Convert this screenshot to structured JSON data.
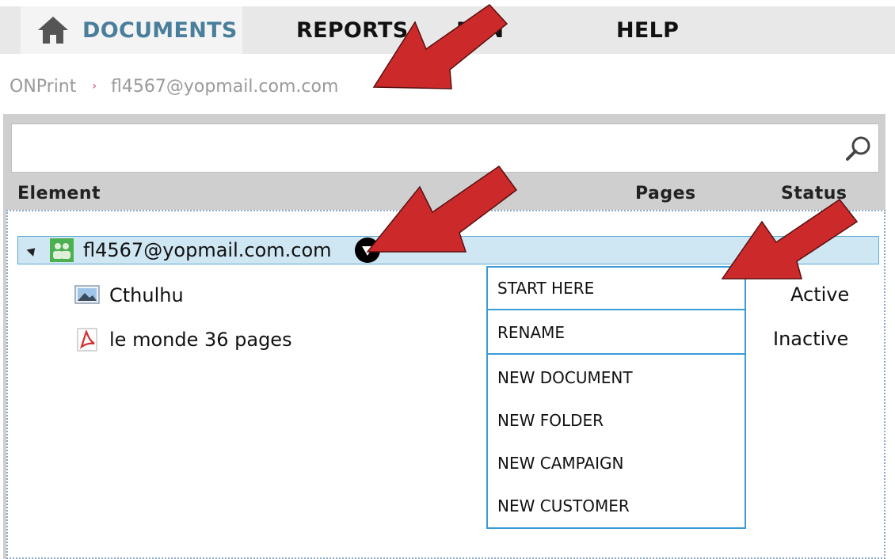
{
  "nav": {
    "tabs": [
      {
        "label": "DOCUMENTS",
        "active": true,
        "icon": "home-icon"
      },
      {
        "label": "REPORTS",
        "active": false
      },
      {
        "label": "MIN",
        "active": false
      },
      {
        "label": "HELP",
        "active": false
      }
    ]
  },
  "breadcrumb": {
    "root": "ONPrint",
    "separator": "›",
    "current": "fl4567@yopmail.com.com"
  },
  "search": {
    "value": "",
    "icon": "search-icon"
  },
  "table": {
    "columns": [
      "Element",
      "Pages",
      "Status"
    ],
    "root": {
      "label": "fl4567@yopmail.com.com",
      "icon": "user-group-icon",
      "expanded": true
    },
    "rows": [
      {
        "label": "Cthulhu",
        "icon": "image-file-icon",
        "status": "Active"
      },
      {
        "label": "le monde 36 pages",
        "icon": "pdf-file-icon",
        "status": "Inactive"
      }
    ]
  },
  "context_menu": {
    "items": [
      "START HERE",
      "RENAME",
      "NEW DOCUMENT",
      "NEW FOLDER",
      "NEW CAMPAIGN",
      "NEW CUSTOMER"
    ]
  },
  "colors": {
    "accent": "#4a7f9c",
    "selection_bg": "#cfe6f3",
    "menu_border": "#3b9bd6",
    "arrow": "#cc2a2a"
  }
}
